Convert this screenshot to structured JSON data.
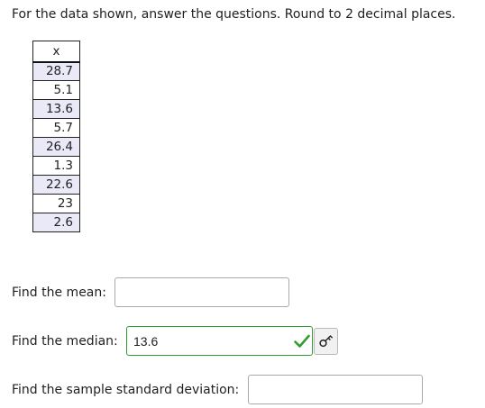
{
  "instructions": "For the data shown, answer the questions. Round to 2 decimal places.",
  "table": {
    "header": "x",
    "values": [
      "28.7",
      "5.1",
      "13.6",
      "5.7",
      "26.4",
      "1.3",
      "22.6",
      "23",
      "2.6"
    ]
  },
  "questions": {
    "mean": {
      "label": "Find the mean:",
      "value": ""
    },
    "median": {
      "label": "Find the median:",
      "value": "13.6",
      "status": "correct"
    },
    "sd": {
      "label": "Find the sample standard deviation:",
      "value": ""
    }
  },
  "icons": {
    "check": "check-icon",
    "key": "key-icon"
  },
  "colors": {
    "correct": "#2e9e2e",
    "table_stripe": "#e9e9f8"
  }
}
